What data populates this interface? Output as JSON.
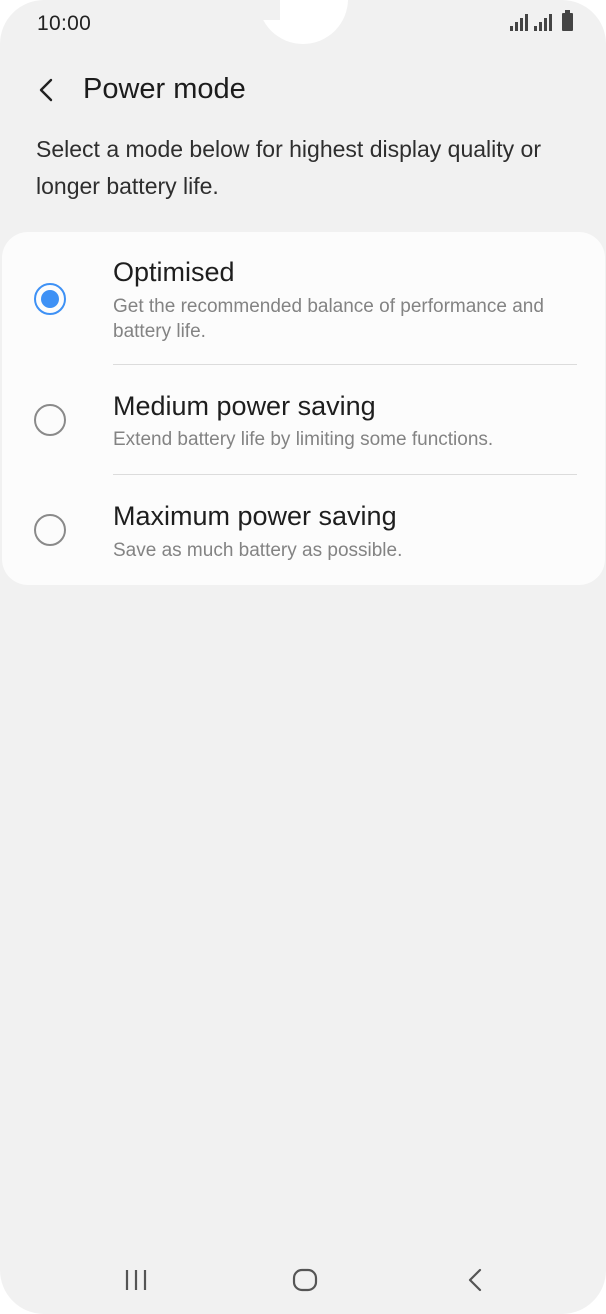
{
  "status_bar": {
    "time": "10:00",
    "icons": [
      "signal-icon",
      "signal-icon",
      "battery-icon"
    ]
  },
  "header": {
    "back_icon": "chevron-left-icon",
    "title": "Power mode"
  },
  "description": "Select a mode below for highest display quality or longer battery life.",
  "modes": [
    {
      "title": "Optimised",
      "subtitle": "Get the recommended balance of performance and battery life.",
      "selected": true
    },
    {
      "title": "Medium power saving",
      "subtitle": "Extend battery life by limiting some functions.",
      "selected": false
    },
    {
      "title": "Maximum power saving",
      "subtitle": "Save as much battery as possible.",
      "selected": false
    }
  ],
  "nav_bar": {
    "icons": [
      "recent-apps-icon",
      "home-icon",
      "back-icon"
    ]
  },
  "colors": {
    "accent": "#3e91f5",
    "background": "#f1f1f1",
    "card": "#fcfcfc",
    "secondary_text": "#838383"
  }
}
